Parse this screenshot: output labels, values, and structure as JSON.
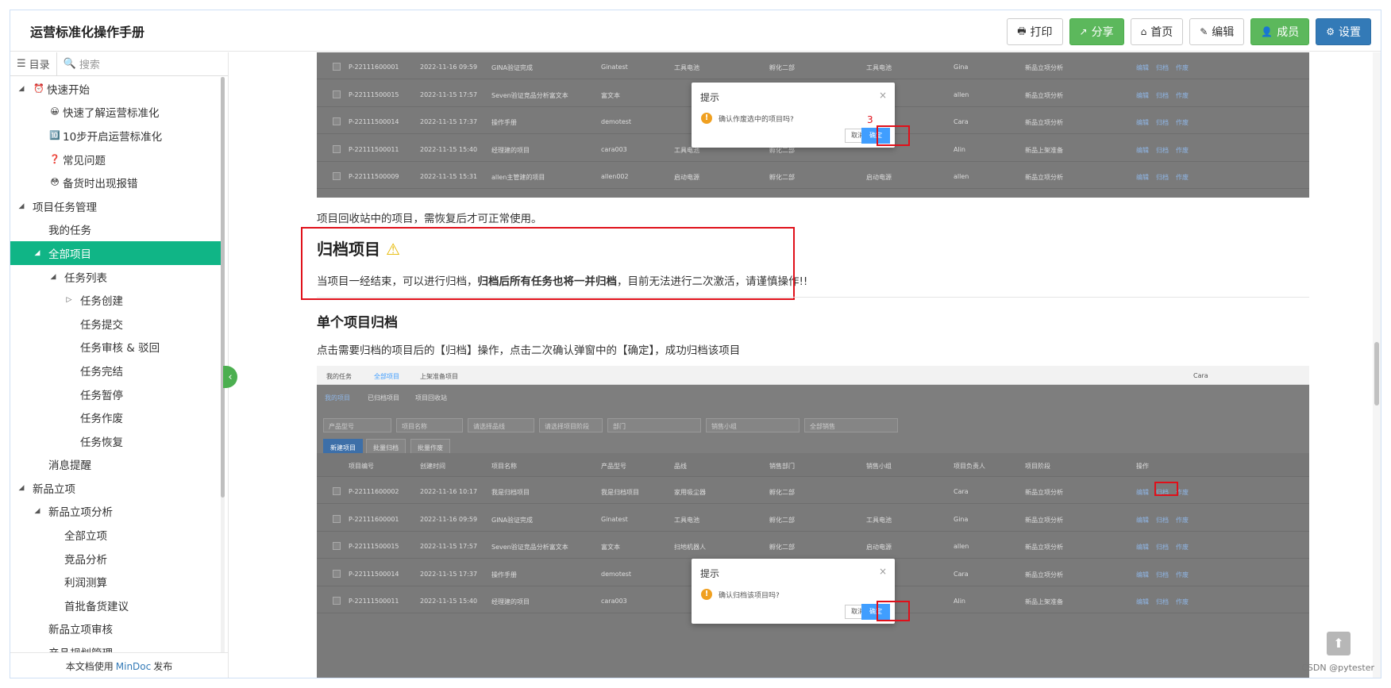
{
  "header": {
    "title": "运营标准化操作手册",
    "buttons": {
      "print": "打印",
      "share": "分享",
      "home": "首页",
      "edit": "编辑",
      "members": "成员",
      "settings": "设置"
    }
  },
  "sidebar": {
    "tab_toc": "目录",
    "search_placeholder": "搜索",
    "tree": [
      {
        "label": "快速开始",
        "level": 0,
        "toggle": "◢",
        "emoji": "⏰"
      },
      {
        "label": "快速了解运营标准化",
        "level": 1,
        "toggle": "",
        "emoji": "😀"
      },
      {
        "label": "10步开启运营标准化",
        "level": 1,
        "toggle": "",
        "emoji": "🔟"
      },
      {
        "label": "常见问题",
        "level": 1,
        "toggle": "",
        "emoji": "❓"
      },
      {
        "label": "备货时出现报错",
        "level": 1,
        "toggle": "",
        "emoji": "😳"
      },
      {
        "label": "项目任务管理",
        "level": 0,
        "toggle": "◢",
        "emoji": ""
      },
      {
        "label": "我的任务",
        "level": 1,
        "toggle": "",
        "emoji": ""
      },
      {
        "label": "全部项目",
        "level": 1,
        "toggle": "◢",
        "emoji": "",
        "active": true
      },
      {
        "label": "任务列表",
        "level": 2,
        "toggle": "◢",
        "emoji": ""
      },
      {
        "label": "任务创建",
        "level": 3,
        "toggle": "▷",
        "emoji": ""
      },
      {
        "label": "任务提交",
        "level": 3,
        "toggle": "",
        "emoji": ""
      },
      {
        "label": "任务审核 & 驳回",
        "level": 3,
        "toggle": "",
        "emoji": ""
      },
      {
        "label": "任务完结",
        "level": 3,
        "toggle": "",
        "emoji": ""
      },
      {
        "label": "任务暂停",
        "level": 3,
        "toggle": "",
        "emoji": ""
      },
      {
        "label": "任务作废",
        "level": 3,
        "toggle": "",
        "emoji": ""
      },
      {
        "label": "任务恢复",
        "level": 3,
        "toggle": "",
        "emoji": ""
      },
      {
        "label": "消息提醒",
        "level": 1,
        "toggle": "",
        "emoji": ""
      },
      {
        "label": "新品立项",
        "level": 0,
        "toggle": "◢",
        "emoji": ""
      },
      {
        "label": "新品立项分析",
        "level": 1,
        "toggle": "◢",
        "emoji": ""
      },
      {
        "label": "全部立项",
        "level": 2,
        "toggle": "",
        "emoji": ""
      },
      {
        "label": "竞品分析",
        "level": 2,
        "toggle": "",
        "emoji": ""
      },
      {
        "label": "利润测算",
        "level": 2,
        "toggle": "",
        "emoji": ""
      },
      {
        "label": "首批备货建议",
        "level": 2,
        "toggle": "",
        "emoji": ""
      },
      {
        "label": "新品立项审核",
        "level": 1,
        "toggle": "",
        "emoji": ""
      },
      {
        "label": "产品规划管理",
        "level": 1,
        "toggle": "",
        "emoji": ""
      }
    ],
    "footer_prefix": "本文档使用",
    "footer_link": "MinDoc",
    "footer_suffix": "发布"
  },
  "content": {
    "shot1": {
      "rows": [
        {
          "id": "P-22111600001",
          "time": "2022-11-16 09:59",
          "name": "GINA验证完成",
          "model": "Ginatest",
          "line": "工具电池",
          "dept": "孵化二部",
          "team": "工具电池",
          "owner": "Gina",
          "stage": "新品立项分析"
        },
        {
          "id": "P-22111500015",
          "time": "2022-11-15 17:57",
          "name": "Seven验证竞品分析富文本",
          "model": "富文本",
          "line": "",
          "dept": "",
          "team": "启动电源",
          "owner": "allen",
          "stage": "新品立项分析"
        },
        {
          "id": "P-22111500014",
          "time": "2022-11-15 17:37",
          "name": "操作手册",
          "model": "demotest",
          "line": "",
          "dept": "",
          "team": "",
          "owner": "Cara",
          "stage": "新品立项分析"
        },
        {
          "id": "P-22111500011",
          "time": "2022-11-15 15:40",
          "name": "经理建的项目",
          "model": "cara003",
          "line": "工具电池",
          "dept": "孵化二部",
          "team": "",
          "owner": "Alin",
          "stage": "新品上架准备"
        },
        {
          "id": "P-22111500009",
          "time": "2022-11-15 15:31",
          "name": "allen主管建的项目",
          "model": "allen002",
          "line": "启动电源",
          "dept": "孵化二部",
          "team": "启动电源",
          "owner": "allen",
          "stage": "新品立项分析"
        }
      ],
      "actions": {
        "edit": "编辑",
        "archive": "归档",
        "void": "作废"
      },
      "modal": {
        "title": "提示",
        "close": "×",
        "message": "确认作废选中的项目吗?",
        "cancel": "取消",
        "ok": "确定",
        "step": "3"
      }
    },
    "recycle_note": "项目回收站中的项目，需恢复后才可正常使用。",
    "archive_title": "归档项目",
    "archive_icon": "⚠",
    "archive_desc_1": "当项目一经结束，可以进行归档，",
    "archive_desc_bold": "归档后所有任务也将一并归档",
    "archive_desc_2": "，目前无法进行二次激活，请谨慎操作!!",
    "single_title": "单个项目归档",
    "single_desc": "点击需要归档的项目后的【归档】操作，点击二次确认弹窗中的【确定】，成功归档该项目",
    "shot2": {
      "tabs": [
        "我的任务",
        "全部项目",
        "上架准备项目"
      ],
      "user": "Cara",
      "subtabs": [
        "我的项目",
        "已归档项目",
        "项目回收站"
      ],
      "filters": [
        "产品型号",
        "项目名称",
        "请选择品线",
        "请选择项目阶段",
        "部门",
        "销售小组",
        "全部销售"
      ],
      "buttons": [
        "新建项目",
        "批量归档",
        "批量作废"
      ],
      "headers": [
        "项目编号",
        "创建时间",
        "项目名称",
        "产品型号",
        "品线",
        "销售部门",
        "销售小组",
        "项目负责人",
        "项目阶段",
        "操作"
      ],
      "rows": [
        {
          "id": "P-22111600002",
          "time": "2022-11-16 10:17",
          "name": "我是归档项目",
          "model": "我是归档项目",
          "line": "家用吸尘器",
          "dept": "孵化二部",
          "team": "",
          "owner": "Cara",
          "stage": "新品立项分析"
        },
        {
          "id": "P-22111600001",
          "time": "2022-11-16 09:59",
          "name": "GINA验证完成",
          "model": "Ginatest",
          "line": "工具电池",
          "dept": "孵化二部",
          "team": "工具电池",
          "owner": "Gina",
          "stage": "新品立项分析"
        },
        {
          "id": "P-22111500015",
          "time": "2022-11-15 17:57",
          "name": "Seven验证竞品分析富文本",
          "model": "富文本",
          "line": "扫地机器人",
          "dept": "孵化二部",
          "team": "启动电源",
          "owner": "allen",
          "stage": "新品立项分析"
        },
        {
          "id": "P-22111500014",
          "time": "2022-11-15 17:37",
          "name": "操作手册",
          "model": "demotest",
          "line": "",
          "dept": "",
          "team": "",
          "owner": "Cara",
          "stage": "新品立项分析"
        },
        {
          "id": "P-22111500011",
          "time": "2022-11-15 15:40",
          "name": "经理建的项目",
          "model": "cara003",
          "line": "",
          "dept": "",
          "team": "",
          "owner": "Alin",
          "stage": "新品上架准备"
        }
      ],
      "modal": {
        "title": "提示",
        "close": "×",
        "message": "确认归档该项目吗?",
        "cancel": "取消",
        "ok": "确定"
      }
    }
  },
  "watermark": "CSDN @pytester",
  "colors": {
    "accent_green": "#10b586",
    "red_box": "#e0101a",
    "primary_blue": "#337ab7"
  }
}
